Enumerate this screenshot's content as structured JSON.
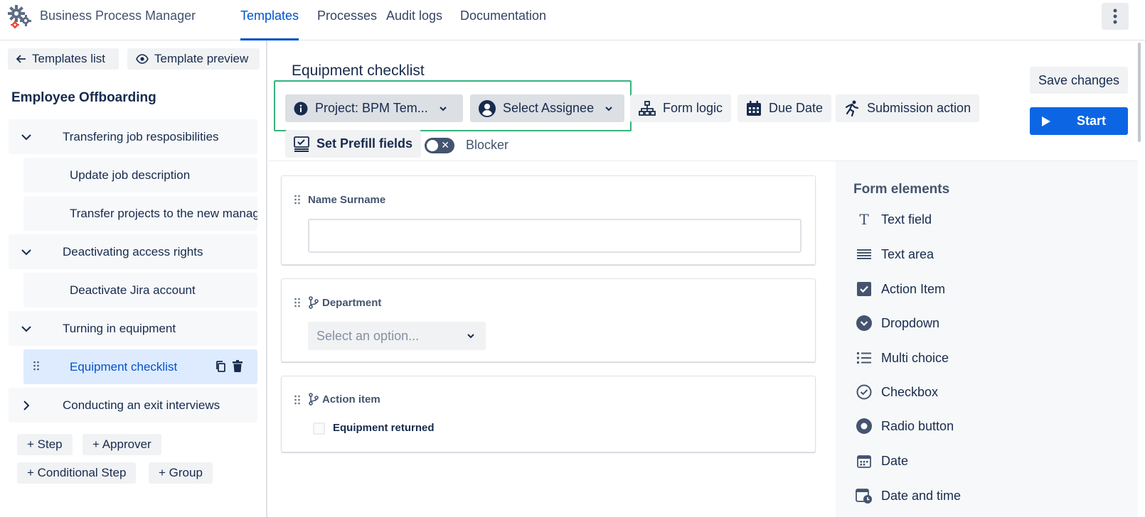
{
  "app": {
    "title": "Business Process Manager"
  },
  "nav": {
    "tabs": [
      {
        "label": "Templates",
        "active": true
      },
      {
        "label": "Processes",
        "active": false
      },
      {
        "label": "Audit logs",
        "active": false
      },
      {
        "label": "Documentation",
        "active": false
      }
    ]
  },
  "left": {
    "templates_list": "Templates list",
    "template_preview": "Template preview",
    "template_name": "Employee Offboarding",
    "tree": [
      {
        "label": "Transfering job resposibilities",
        "type": "group",
        "expanded": true
      },
      {
        "label": "Update job description",
        "type": "child"
      },
      {
        "label": "Transfer projects to the new manager",
        "type": "child"
      },
      {
        "label": "Deactivating access rights",
        "type": "group",
        "expanded": true
      },
      {
        "label": "Deactivate Jira account",
        "type": "child"
      },
      {
        "label": "Turning in equipment",
        "type": "group",
        "expanded": true
      },
      {
        "label": "Equipment checklist",
        "type": "child",
        "selected": true
      },
      {
        "label": "Conducting an exit interviews",
        "type": "group",
        "expanded": false
      }
    ],
    "add_buttons": {
      "step": "+ Step",
      "approver": "+ Approver",
      "conditional_step": "+ Conditional Step",
      "group": "+ Group"
    }
  },
  "main": {
    "title": "Equipment checklist",
    "toolbar": {
      "project": "Project: BPM Tem...",
      "assignee": "Select Assignee",
      "form_logic": "Form logic",
      "due_date": "Due Date",
      "submission_action": "Submission action",
      "set_prefill": "Set Prefill fields",
      "blocker": "Blocker",
      "blocker_on": false
    },
    "save_changes": "Save changes",
    "start": "Start",
    "fields": [
      {
        "label": "Name Surname",
        "kind": "text",
        "value": ""
      },
      {
        "label": "Department",
        "kind": "select",
        "placeholder": "Select an option..."
      },
      {
        "label": "Action item",
        "kind": "action",
        "checkbox_label": "Equipment returned",
        "checked": false
      }
    ]
  },
  "form_elements": {
    "title": "Form elements",
    "items": [
      {
        "label": "Text field",
        "icon": "text-field-icon"
      },
      {
        "label": "Text area",
        "icon": "text-area-icon"
      },
      {
        "label": "Action Item",
        "icon": "checkbox-checked-icon"
      },
      {
        "label": "Dropdown",
        "icon": "dropdown-circle-icon"
      },
      {
        "label": "Multi choice",
        "icon": "list-bullets-icon"
      },
      {
        "label": "Checkbox",
        "icon": "check-circle-icon"
      },
      {
        "label": "Radio button",
        "icon": "radio-icon"
      },
      {
        "label": "Date",
        "icon": "calendar-icon"
      },
      {
        "label": "Date and time",
        "icon": "calendar-clock-icon"
      }
    ]
  },
  "colors": {
    "primary": "#0c66e4",
    "highlight_border": "#36b37e",
    "selected_bg": "#deebff"
  }
}
